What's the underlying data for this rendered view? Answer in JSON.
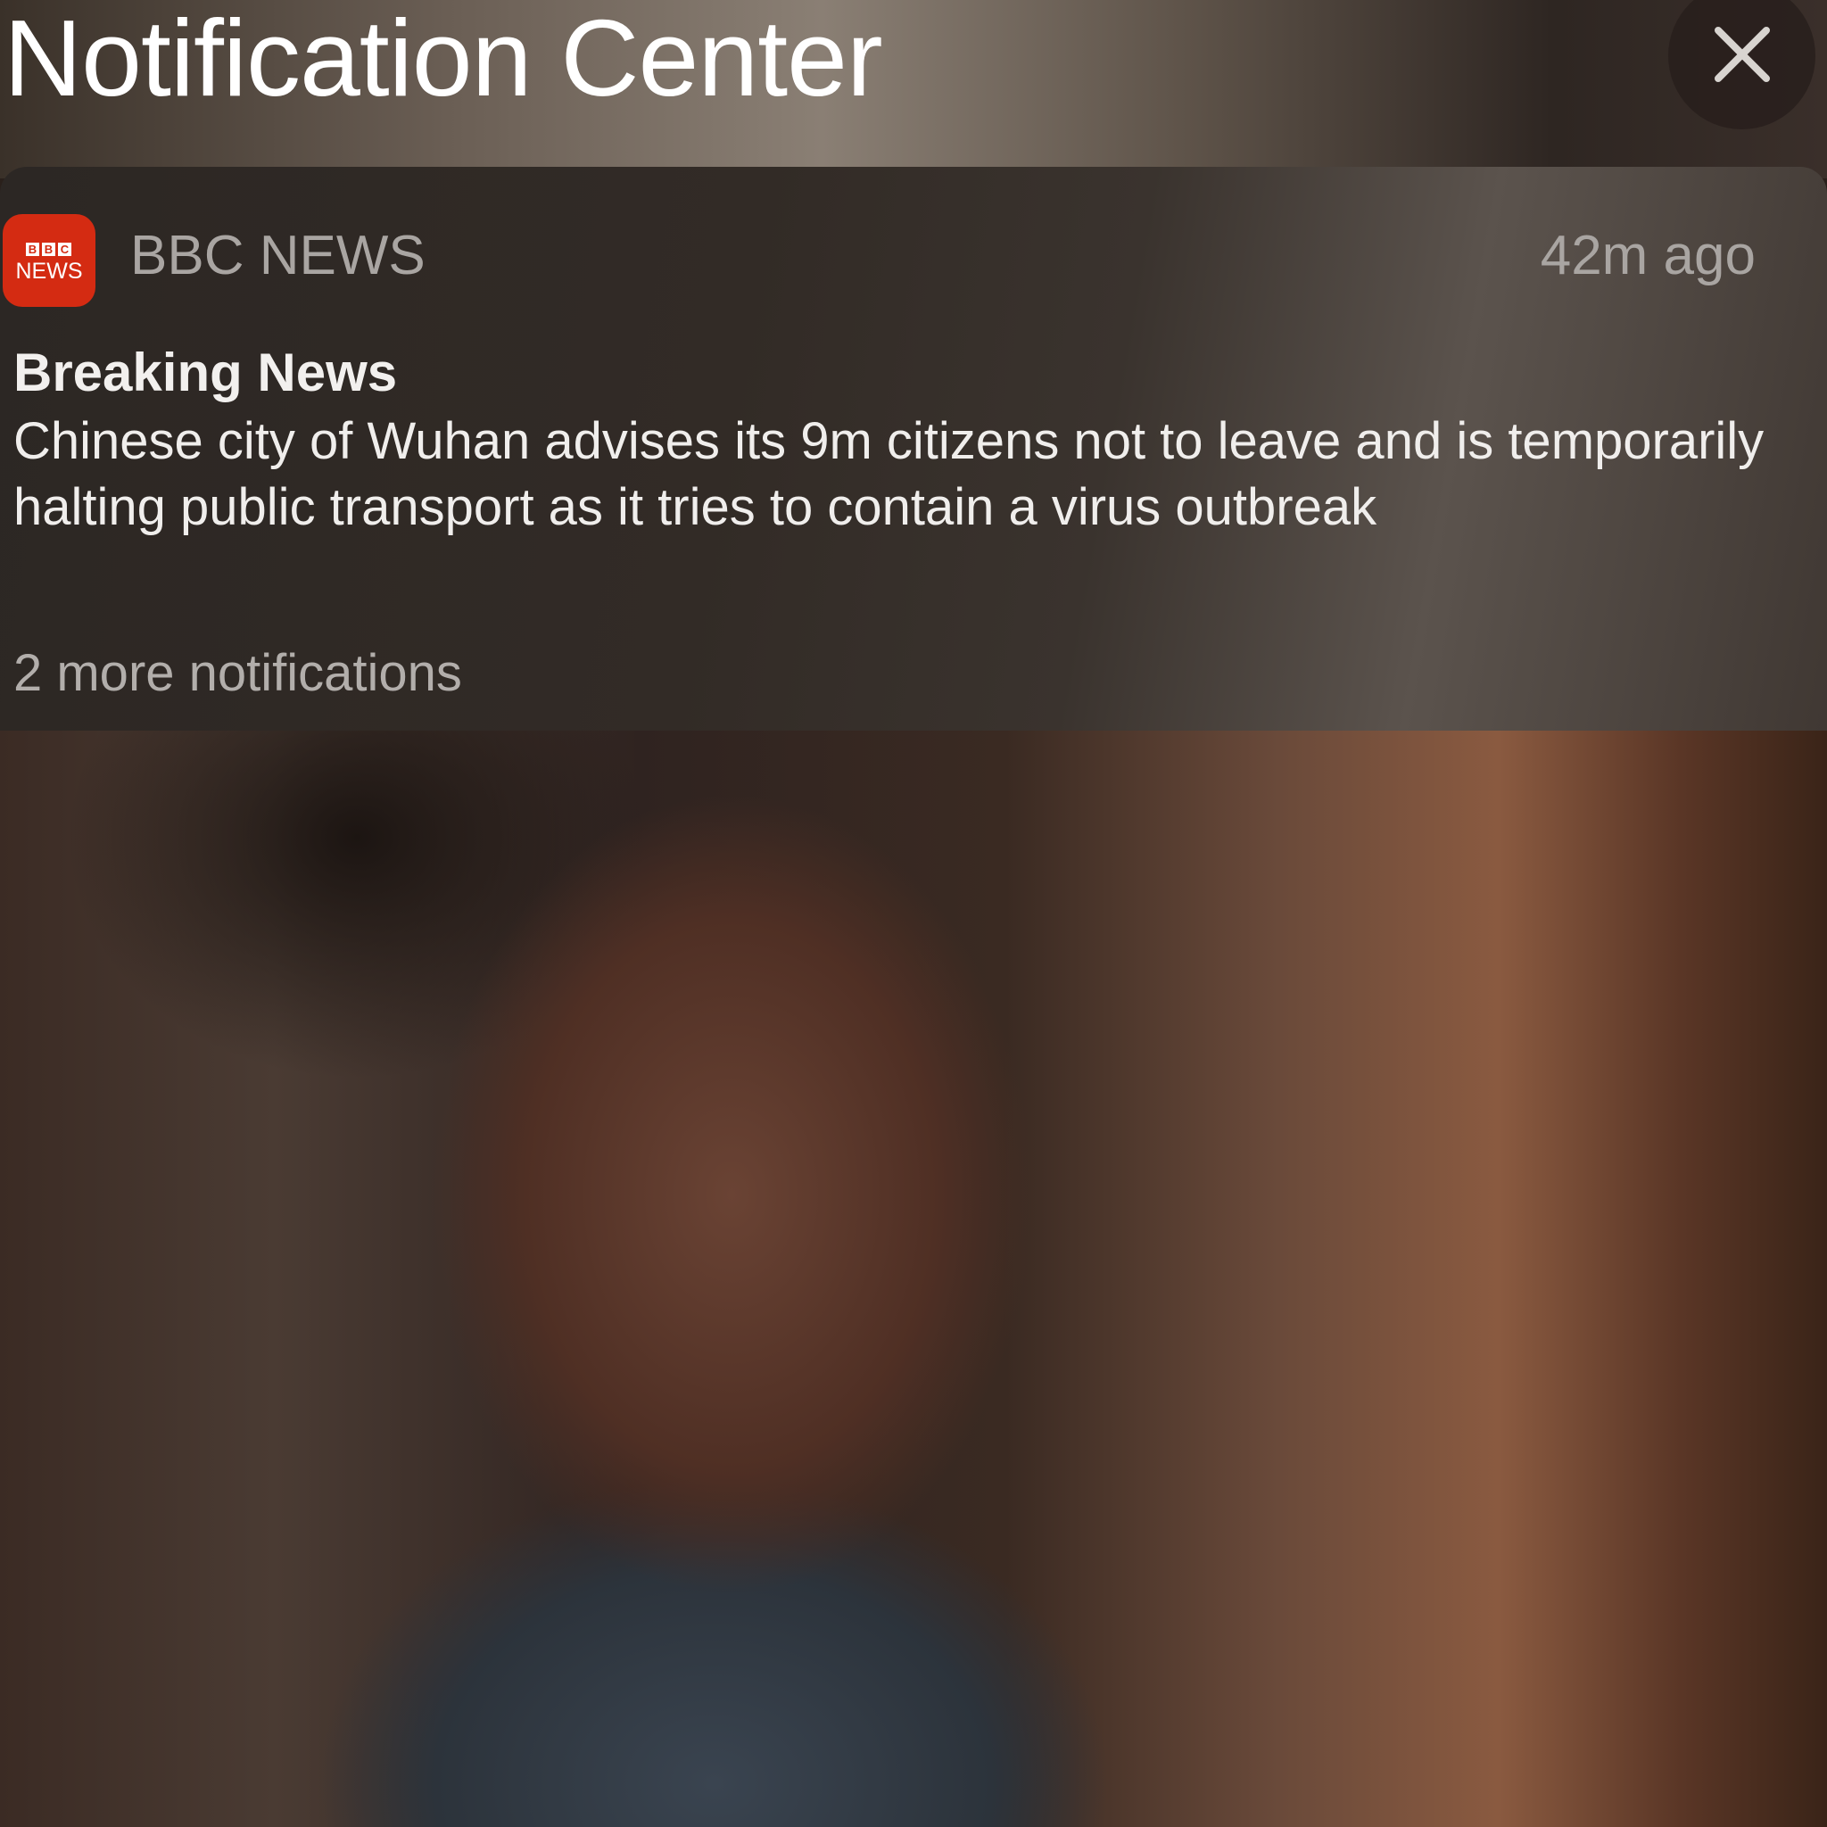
{
  "header": {
    "title": "Notification Center",
    "close_icon": "close-icon"
  },
  "notification": {
    "app_name": "BBC NEWS",
    "app_icon": {
      "name": "bbc-news-app-icon",
      "letters": [
        "B",
        "B",
        "C"
      ],
      "subtitle": "NEWS",
      "color": "#d42b12"
    },
    "time": "42m ago",
    "headline": "Breaking News",
    "body": "Chinese city of Wuhan advises its 9m citizens not to leave and is temporarily halting public transport as it tries to contain a virus outbreak",
    "more": "2 more notifications"
  }
}
